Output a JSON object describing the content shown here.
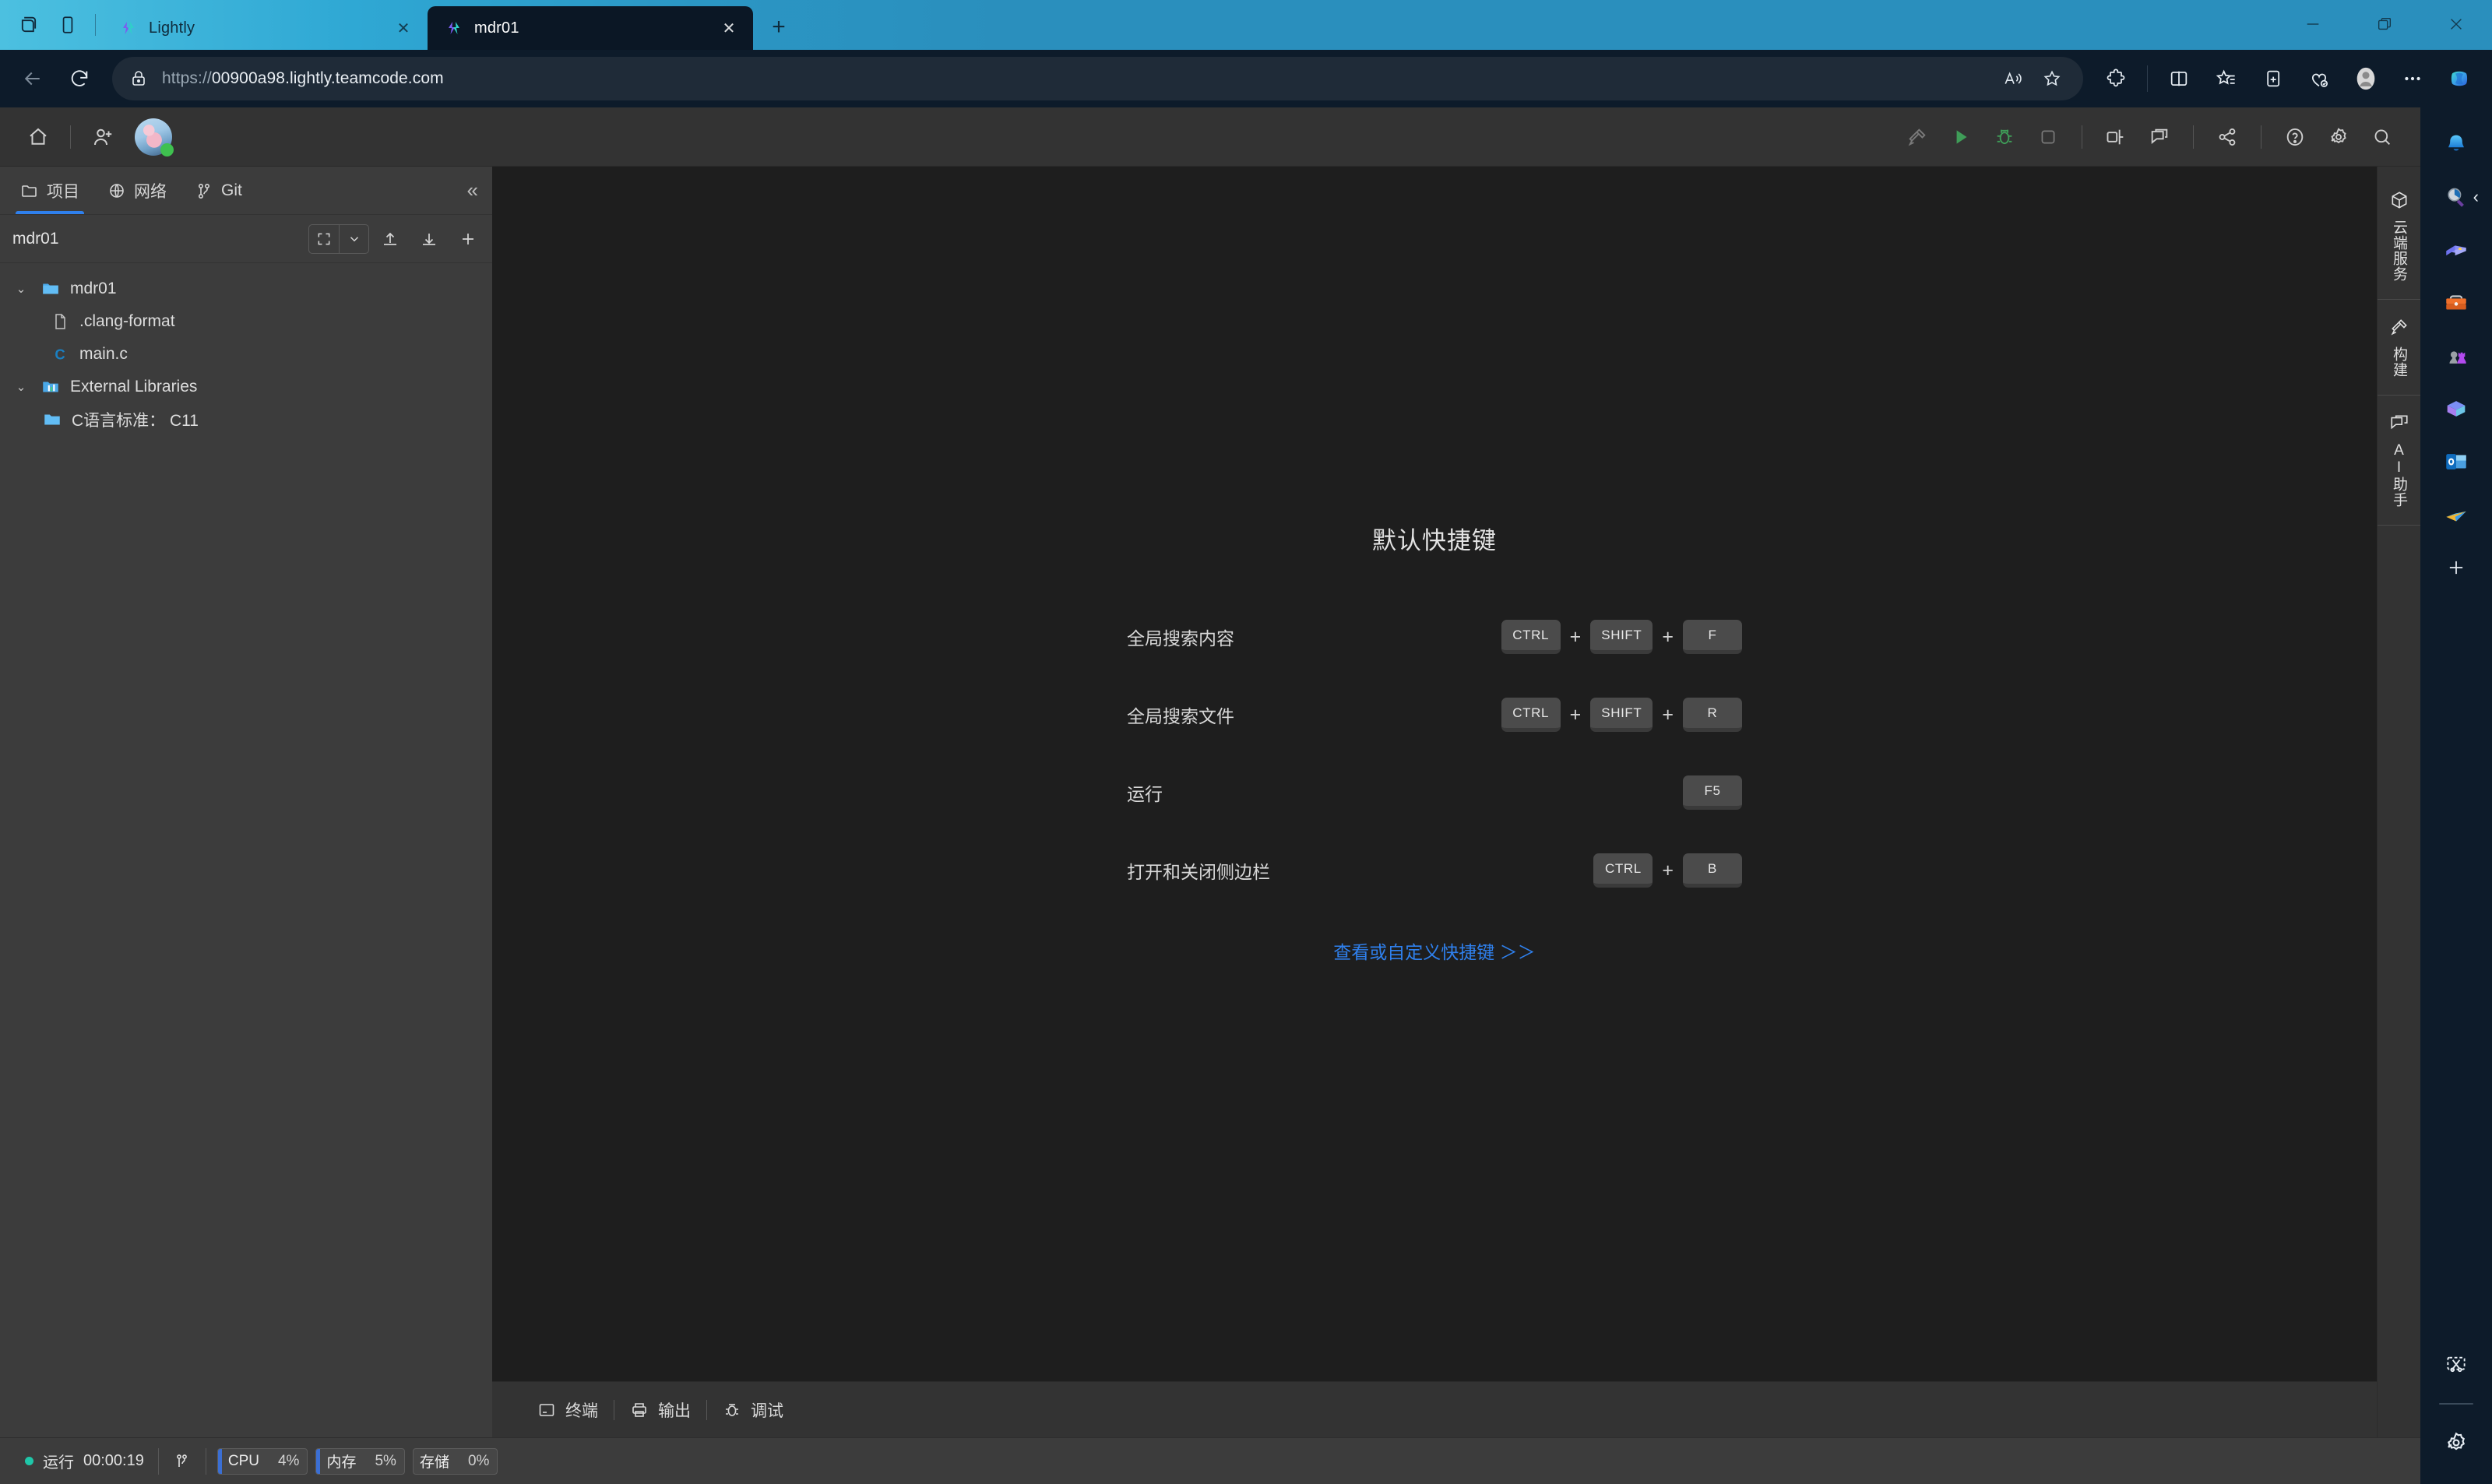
{
  "browser": {
    "window_controls": {
      "minimize": "—",
      "restore": "restore-icon",
      "close": "✕"
    },
    "tab_actions_icon": "tab-actions-icon",
    "tab_collections_icon": "split-screen-icon",
    "tabs": [
      {
        "title": "Lightly",
        "favicon": "lightly-favicon",
        "close": "✕",
        "active": false
      },
      {
        "title": "mdr01",
        "favicon": "lightly-favicon",
        "close": "✕",
        "active": true
      }
    ],
    "new_tab_label": "+",
    "nav": {
      "back": "back-arrow-icon",
      "refresh": "refresh-icon"
    },
    "omnibox": {
      "lock_icon": "lock-icon",
      "scheme": "https://",
      "host": "00900a98.lightly.teamcode.com",
      "read_aloud": "read-aloud-icon",
      "favorite": "star-icon"
    },
    "toolbar_icons": [
      "extensions-icon",
      "split-screen-icon",
      "favorites-icon",
      "collections-icon",
      "browser-essentials-icon",
      "profile-avatar-icon",
      "more-options-icon",
      "copilot-icon"
    ],
    "sidebar_items": [
      "notifications-bell-icon",
      "search-icon",
      "shopping-tag-icon",
      "tools-briefcase-icon",
      "games-icon",
      "office-icon",
      "outlook-icon",
      "send-plane-icon",
      "add-sidebar-icon"
    ],
    "sidebar_bottom": [
      "screenshot-scissors-icon",
      "settings-gear-icon"
    ]
  },
  "ide": {
    "topbar": {
      "home_icon": "home-icon",
      "invite_icon": "add-user-icon",
      "avatar": "user-avatar",
      "status": "online",
      "right_icons": [
        "build-hammer-icon",
        "run-icon",
        "debug-icon",
        "stop-icon",
        "layout-panel-icon",
        "comments-icon",
        "share-icon",
        "help-icon",
        "settings-gear-icon",
        "search-icon"
      ]
    },
    "explorer": {
      "tabs": [
        {
          "label": "项目",
          "icon": "folder-icon",
          "active": true
        },
        {
          "label": "网络",
          "icon": "globe-icon",
          "active": false
        },
        {
          "label": "Git",
          "icon": "git-branch-icon",
          "active": false
        }
      ],
      "collapse_icon": "«",
      "project_name": "mdr01",
      "actions": [
        "expand-collapse-icon",
        "chevron-down-icon",
        "upload-icon",
        "download-icon",
        "add-icon"
      ],
      "tree": [
        {
          "label": "mdr01",
          "icon": "folder-open-icon",
          "indent": 0,
          "chevron": "⌄",
          "expanded": true
        },
        {
          "label": ".clang-format",
          "icon": "file-icon",
          "indent": 1,
          "chevron": "",
          "expanded": false
        },
        {
          "label": "main.c",
          "icon": "c-file-icon",
          "indent": 1,
          "chevron": "",
          "expanded": false
        },
        {
          "label": "External Libraries",
          "icon": "libraries-icon",
          "indent": 0,
          "chevron": "⌄",
          "expanded": true
        },
        {
          "label": "C语言标准： C11",
          "icon": "folder-icon",
          "indent": 1,
          "chevron": "",
          "expanded": false
        }
      ]
    },
    "welcome": {
      "title": "默认快捷键",
      "shortcuts": [
        {
          "label": "全局搜索内容",
          "keys": [
            "CTRL",
            "SHIFT",
            "F"
          ]
        },
        {
          "label": "全局搜索文件",
          "keys": [
            "CTRL",
            "SHIFT",
            "R"
          ]
        },
        {
          "label": "运行",
          "keys": [
            "F5"
          ]
        },
        {
          "label": "打开和关闭侧边栏",
          "keys": [
            "CTRL",
            "B"
          ]
        }
      ],
      "plus": "+",
      "link": "查看或自定义快捷键 ＞＞"
    },
    "panel_tabs": [
      {
        "label": "终端",
        "icon": "terminal-icon"
      },
      {
        "label": "输出",
        "icon": "output-printer-icon"
      },
      {
        "label": "调试",
        "icon": "debug-bug-icon"
      }
    ],
    "tool_strip": [
      {
        "label": "云端服务",
        "icon": "cloud-cube-icon"
      },
      {
        "label": "构建",
        "icon": "hammer-icon"
      },
      {
        "label": "AI助手",
        "icon": "ai-chat-icon"
      }
    ],
    "statusbar": {
      "run_label": "运行",
      "run_time": "00:00:19",
      "git_icon": "git-branch-icon",
      "meters": [
        {
          "name": "CPU",
          "value": "4%"
        },
        {
          "name": "内存",
          "value": "5%"
        },
        {
          "name": "存储",
          "value": "0%"
        }
      ]
    }
  },
  "colors": {
    "titlebar": "#2fa8d4",
    "browser_chrome": "#0d1b2a",
    "ide_chrome": "#333333",
    "explorer_bg": "#3c3c3c",
    "editor_bg": "#1e1e1e",
    "accent_blue": "#2f80ed",
    "run_green": "#3f9d58",
    "status_online": "#3fc14f"
  }
}
